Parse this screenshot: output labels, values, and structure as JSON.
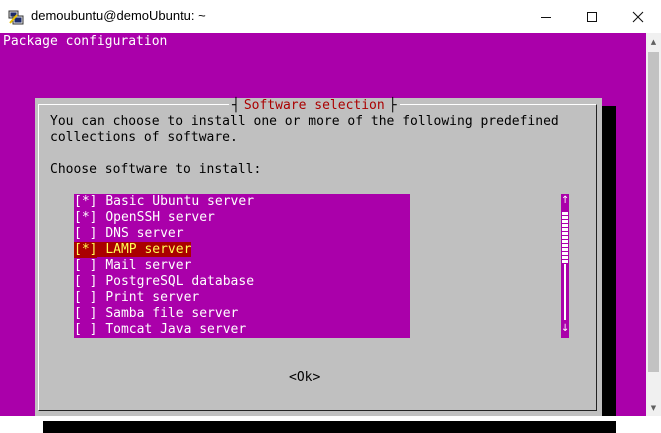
{
  "window": {
    "title": "demoubuntu@demoUbuntu: ~",
    "minimize_glyph": "—",
    "maximize_glyph": "☐",
    "close_glyph": "✕"
  },
  "terminal": {
    "header": "Package configuration",
    "background_color": "#aa00aa"
  },
  "dialog": {
    "title": "Software selection",
    "intro_line1": "You can choose to install one or more of the following predefined",
    "intro_line2": "collections of software.",
    "prompt": "Choose software to install:",
    "ok_label": "<Ok>",
    "items": [
      {
        "mark": "[*]",
        "label": "Basic Ubuntu server",
        "checked": true,
        "focused": false
      },
      {
        "mark": "[*]",
        "label": "OpenSSH server",
        "checked": true,
        "focused": false
      },
      {
        "mark": "[ ]",
        "label": "DNS server",
        "checked": false,
        "focused": false
      },
      {
        "mark": "[*]",
        "label": "LAMP server",
        "checked": true,
        "focused": true
      },
      {
        "mark": "[ ]",
        "label": "Mail server",
        "checked": false,
        "focused": false
      },
      {
        "mark": "[ ]",
        "label": "PostgreSQL database",
        "checked": false,
        "focused": false
      },
      {
        "mark": "[ ]",
        "label": "Print server",
        "checked": false,
        "focused": false
      },
      {
        "mark": "[ ]",
        "label": "Samba file server",
        "checked": false,
        "focused": false
      },
      {
        "mark": "[ ]",
        "label": "Tomcat Java server",
        "checked": false,
        "focused": false
      }
    ],
    "scroll_up": "↑",
    "scroll_down": "↓"
  },
  "colors": {
    "highlight_bg": "#aa0000",
    "highlight_fg": "#ffff55",
    "dialog_bg": "#c0c0c0"
  }
}
